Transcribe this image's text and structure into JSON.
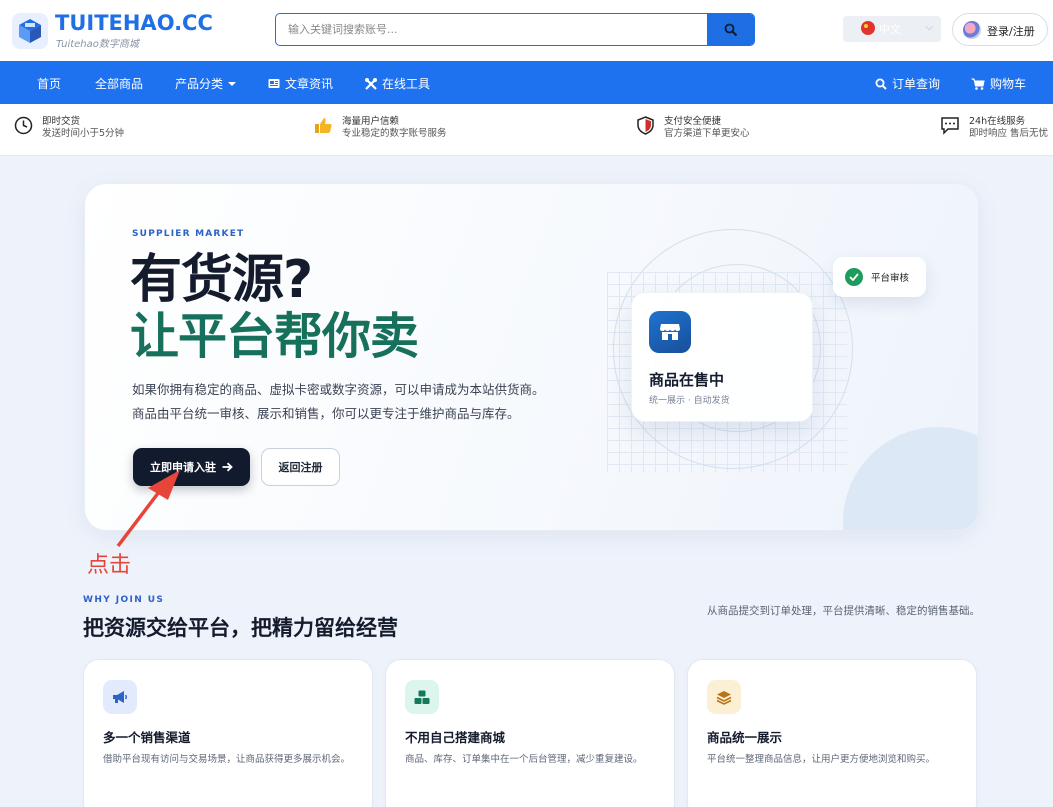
{
  "brand": {
    "title": "TUITEHAO.CC",
    "subtitle": "Tuitehao数字商城"
  },
  "search": {
    "placeholder": "输入关键词搜索账号..."
  },
  "language": {
    "label": "中文"
  },
  "login": {
    "label": "登录/注册"
  },
  "nav": {
    "items": [
      {
        "label": "首页",
        "icon": ""
      },
      {
        "label": "全部商品",
        "icon": ""
      },
      {
        "label": "产品分类",
        "icon": "caret-down-icon"
      },
      {
        "label": "文章资讯",
        "icon": "article-icon"
      },
      {
        "label": "在线工具",
        "icon": "tools-icon"
      }
    ],
    "right": [
      {
        "label": "订单查询",
        "icon": "search-icon"
      },
      {
        "label": "购物车",
        "icon": "cart-icon"
      }
    ]
  },
  "features": [
    {
      "icon": "clock-icon",
      "title": "即时交货",
      "desc": "发送时间小于5分钟"
    },
    {
      "icon": "thumbs-up-icon",
      "title": "海量用户信赖",
      "desc": "专业稳定的数字账号服务"
    },
    {
      "icon": "shield-icon",
      "title": "支付安全便捷",
      "desc": "官方渠道下单更安心"
    },
    {
      "icon": "chat-icon",
      "title": "24h在线服务",
      "desc": "即时响应 售后无忧"
    }
  ],
  "hero": {
    "eyebrow": "SUPPLIER MARKET",
    "heading_line1": "有货源?",
    "heading_line2": "让平台帮你卖",
    "desc_line1": "如果你拥有稳定的商品、虚拟卡密或数字资源，可以申请成为本站供货商。",
    "desc_line2": "商品由平台统一审核、展示和销售，你可以更专注于维护商品与库存。",
    "primary_button": "立即申请入驻",
    "secondary_button": "返回注册",
    "card_title": "商品在售中",
    "card_subtitle": "统一展示 · 自动发货",
    "badge_label": "平台审核"
  },
  "annotation": {
    "label": "点击",
    "color": "#e8453a"
  },
  "why": {
    "eyebrow": "WHY JOIN US",
    "title": "把资源交给平台，把精力留给经营",
    "desc": "从商品提交到订单处理，平台提供清晰、稳定的销售基础。"
  },
  "benefits": [
    {
      "icon": "megaphone-icon",
      "title": "多一个销售渠道",
      "desc": "借助平台现有访问与交易场景，让商品获得更多展示机会。"
    },
    {
      "icon": "cubes-icon",
      "title": "不用自己搭建商城",
      "desc": "商品、库存、订单集中在一个后台管理，减少重复建设。"
    },
    {
      "icon": "layers-icon",
      "title": "商品统一展示",
      "desc": "平台统一整理商品信息，让用户更方便地浏览和购买。"
    }
  ],
  "colors": {
    "primary": "#1e72f0",
    "dark": "#121a2e",
    "green_heading": "#16705b"
  }
}
